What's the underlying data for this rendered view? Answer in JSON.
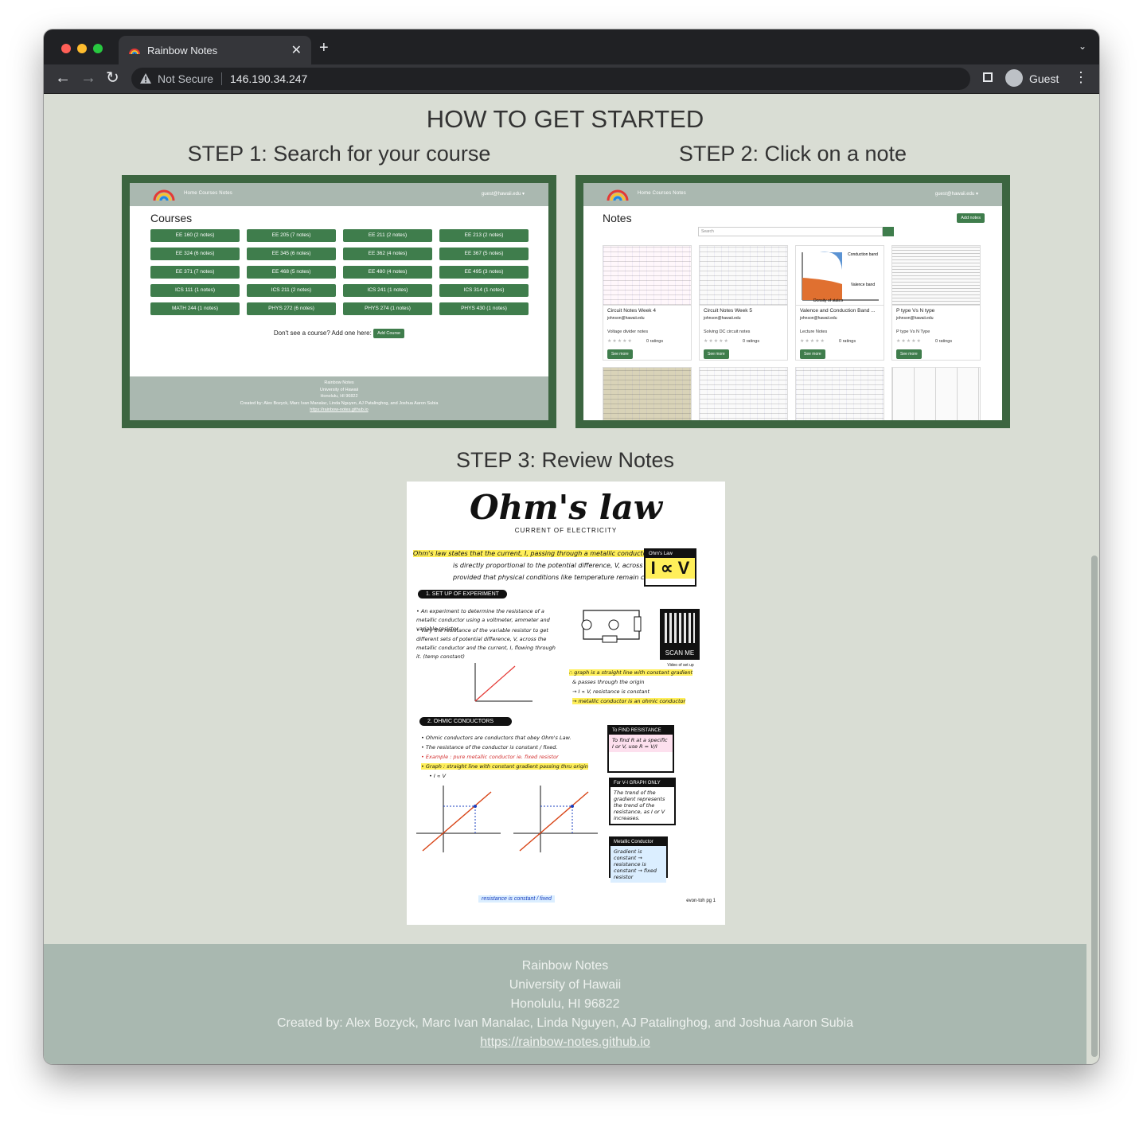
{
  "browser": {
    "tab_title": "Rainbow Notes",
    "security_label": "Not Secure",
    "url": "146.190.34.247",
    "profile_label": "Guest"
  },
  "page": {
    "heading": "HOW TO GET STARTED",
    "step1_title": "STEP 1: Search for your course",
    "step2_title": "STEP 2: Click on a note",
    "step3_title": "STEP 3: Review Notes"
  },
  "step1_screenshot": {
    "nav_links": "Home  Courses  Notes",
    "nav_user": "guest@hawaii.edu ▾",
    "heading": "Courses",
    "courses": [
      "EE 160 (2 notes)",
      "EE 205 (7 notes)",
      "EE 211 (2 notes)",
      "EE 213 (2 notes)",
      "EE 324 (6 notes)",
      "EE 345 (6 notes)",
      "EE 362 (4 notes)",
      "EE 367 (5 notes)",
      "EE 371 (7 notes)",
      "EE 468 (5 notes)",
      "EE 480 (4 notes)",
      "EE 495 (3 notes)",
      "ICS 111 (1 notes)",
      "ICS 211 (2 notes)",
      "ICS 241 (1 notes)",
      "ICS 314 (1 notes)",
      "MATH 244 (1 notes)",
      "PHYS 272 (6 notes)",
      "PHYS 274 (1 notes)",
      "PHYS 430 (1 notes)"
    ],
    "add_prompt": "Don't see a course? Add one here:",
    "add_button": "Add Course",
    "footer_lines": [
      "Rainbow Notes",
      "University of Hawaii",
      "Honolulu, HI 96822",
      "Created by: Alex Bozyck, Marc Ivan Manalac, Linda Nguyen, AJ Patalinghog, and Joshua Aaron Subia",
      "https://rainbow-notes.github.io"
    ]
  },
  "step2_screenshot": {
    "nav_links": "Home  Courses  Notes",
    "nav_user": "guest@hawaii.edu ▾",
    "heading": "Notes",
    "add_button": "Add notes",
    "search_placeholder": "Search",
    "cards": [
      {
        "title": "Circuit Notes Week 4",
        "email": "johnson@hawaii.edu",
        "desc": "Voltage divider notes",
        "ratings": "0 ratings",
        "button": "See more"
      },
      {
        "title": "Circuit Notes Week 5",
        "email": "johnson@hawaii.edu",
        "desc": "Solving DC circuit notes",
        "ratings": "0 ratings",
        "button": "See more"
      },
      {
        "title": "Valence and Conduction Band ...",
        "email": "johnson@hawaii.edu",
        "desc": "Lecture Notes",
        "ratings": "0 ratings",
        "button": "See more"
      },
      {
        "title": "P type Vs N type",
        "email": "johnson@hawaii.edu",
        "desc": "P type Vs N Type",
        "ratings": "0 ratings",
        "button": "See more"
      }
    ],
    "band_labels": {
      "conduction": "Conduction band",
      "valence": "Valence band",
      "density": "Density of states"
    }
  },
  "step3_poster": {
    "title": "Ohm's law",
    "subtitle": "CURRENT OF ELECTRICITY",
    "intro_1": "Ohm's law states that the current, I, passing through a metallic conductor",
    "intro_2": "is directly proportional to the potential difference, V, across it,",
    "intro_3": "provided that physical conditions like temperature remain constant.",
    "formula_label": "Ohm's Law",
    "formula": "I ∝ V",
    "section1": "1.  SET UP OF EXPERIMENT",
    "section1_b1": "• An experiment to determine the resistance of a metallic conductor using a voltmeter, ammeter and variable resistor",
    "section1_b2": "• Vary the resistance of the variable resistor to get different sets of potential difference, V, across the metallic conductor and the current, I, flowing through it. (temp constant)",
    "scan_label": "SCAN ME",
    "video_label": "Video of set up",
    "graph_note_1": "∴ graph is a straight line with constant gradient",
    "graph_note_2": "& passes through the origin",
    "graph_note_3": "→ I ∝ V, resistance is constant",
    "graph_note_4": "→ metallic conductor is an ohmic conductor",
    "section2": "2.  OHMIC CONDUCTORS",
    "section2_b1": "• Ohmic conductors are conductors that obey Ohm's Law.",
    "section2_b2": "• The resistance of the conductor is constant / fixed.",
    "section2_b3": "• Example : pure metallic conductor ie. fixed resistor",
    "section2_b4": "• Graph : straight line with constant gradient passing thru origin",
    "section2_b5": "• I ∝ V",
    "box1_head": "To FIND RESISTANCE",
    "box1_body": "To find R at a specific I or V, use R = V/I",
    "box2_head": "For V-I GRAPH ONLY",
    "box2_body": "The trend of the gradient represents the trend of the resistance, as I or V increases.",
    "box3_head": "Metallic Conductor",
    "box3_body": "Gradient is constant → resistance is constant → fixed resistor",
    "bottom_note": "resistance is constant / fixed",
    "signature": "evon·toh  pg 1"
  },
  "footer": {
    "line1": "Rainbow Notes",
    "line2": "University of Hawaii",
    "line3": "Honolulu, HI 96822",
    "line4": "Created by: Alex Bozyck, Marc Ivan Manalac, Linda Nguyen, AJ Patalinghog, and Joshua Aaron Subia",
    "link": "https://rainbow-notes.github.io"
  },
  "colors": {
    "page_bg": "#d9ddd4",
    "frame_green": "#3c6540",
    "button_green": "#3f7d4c",
    "footer_bg": "#a9b8b0"
  }
}
